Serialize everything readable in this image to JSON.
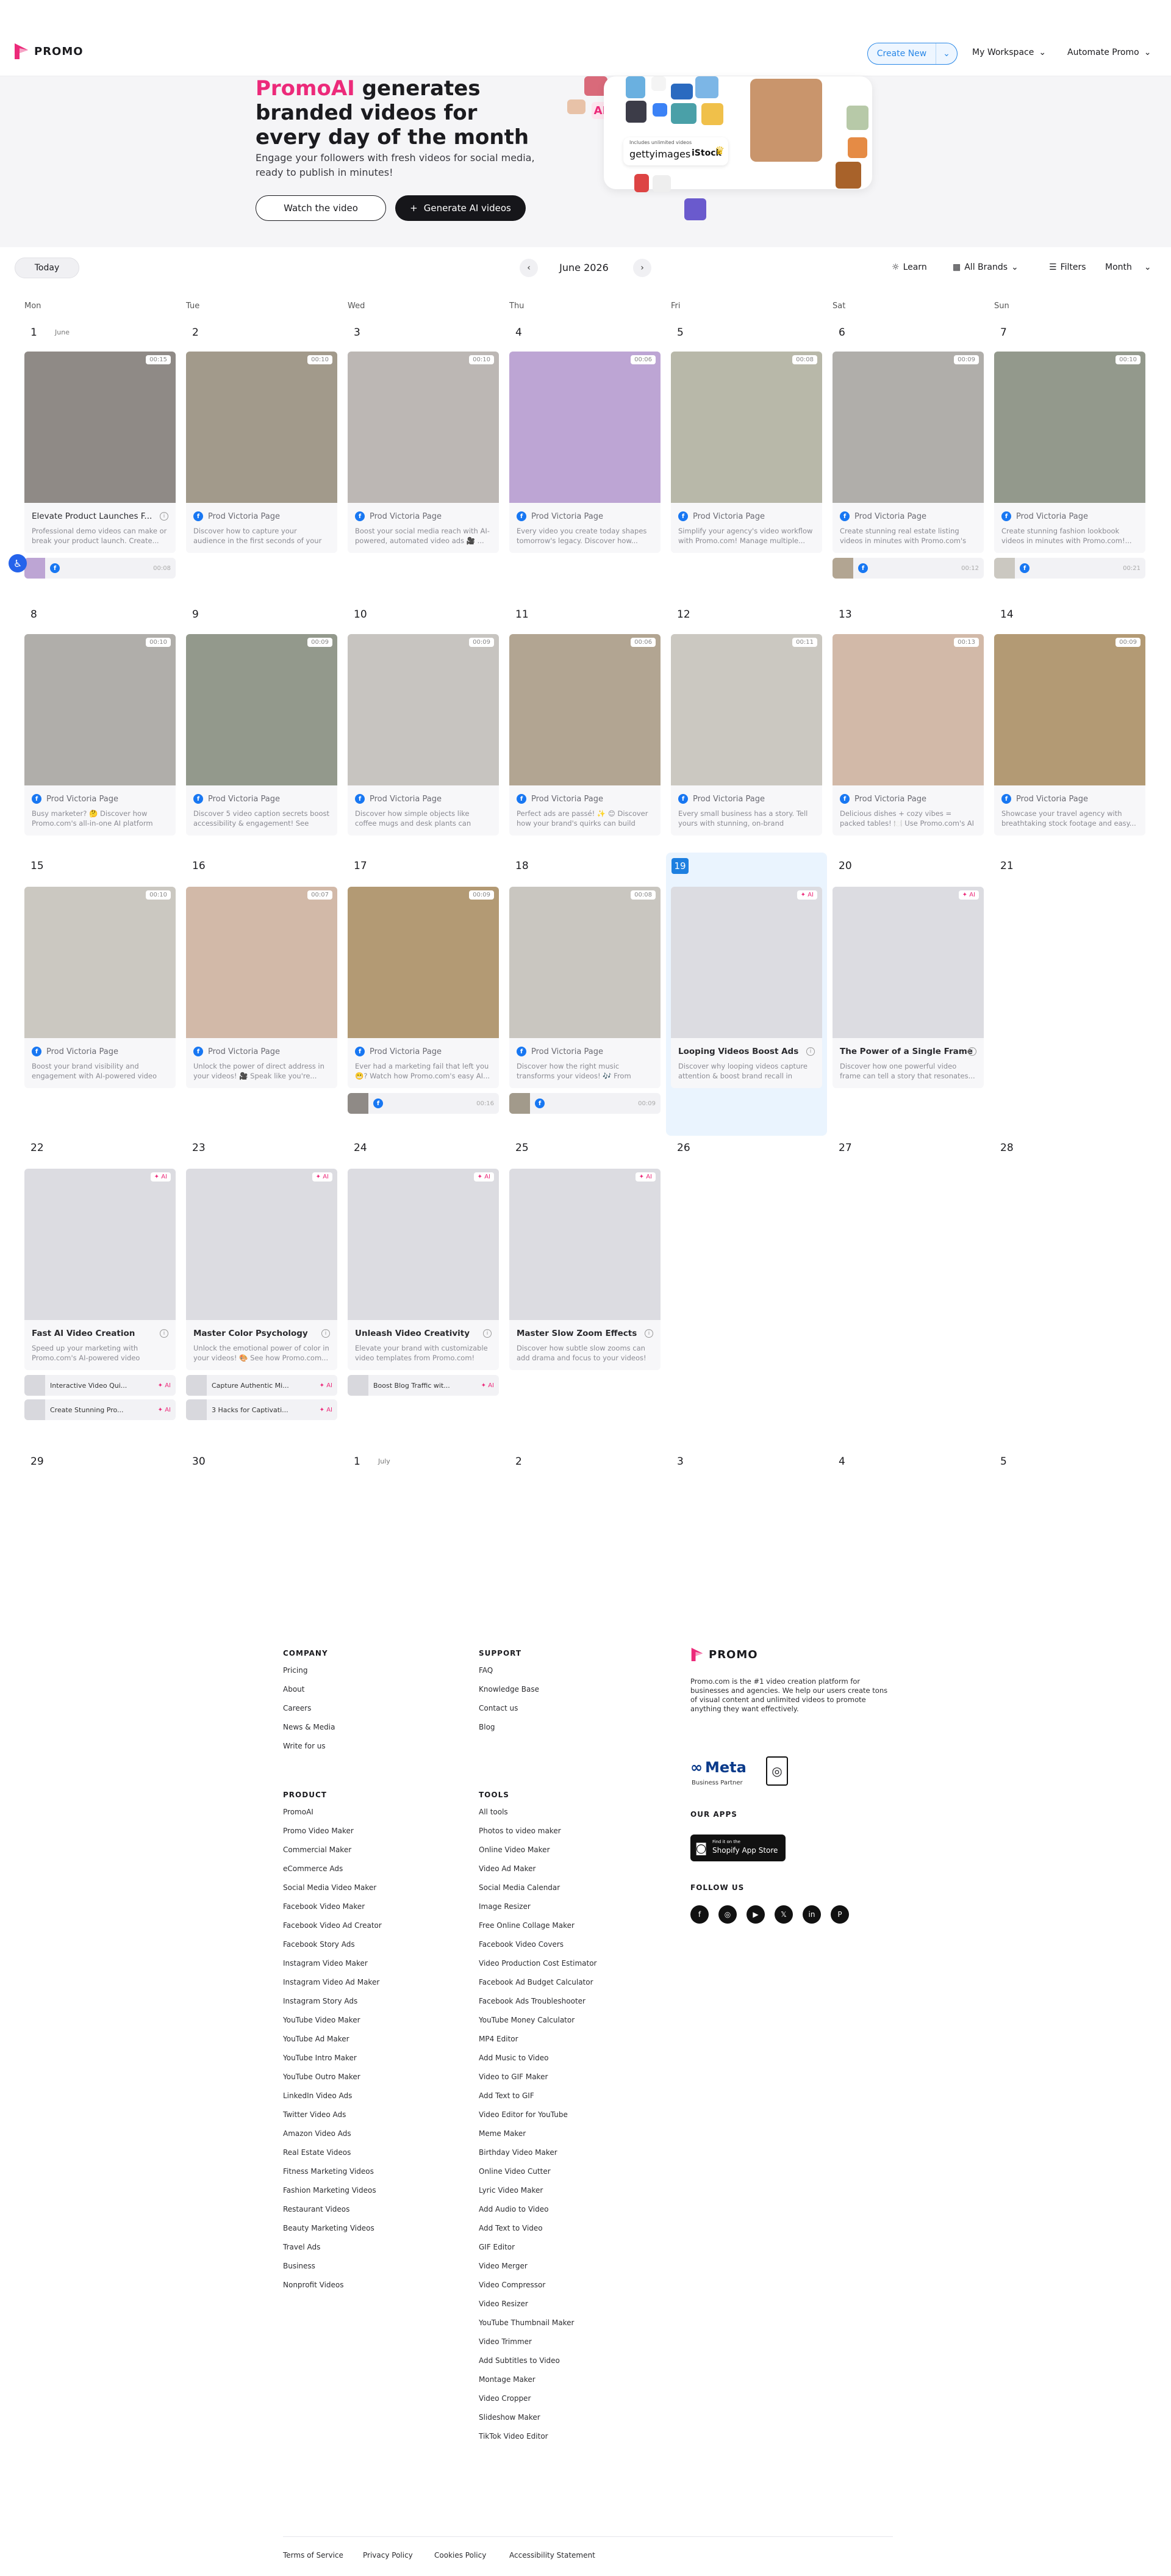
{
  "header": {
    "logo_text": "PROMO",
    "create_new": "Create New",
    "my_workspace": "My Workspace",
    "automate_promo": "Automate Promo"
  },
  "hero": {
    "title_highlight": "PromoAI",
    "title_rest": " generates branded videos for every day of the month",
    "subtitle": "Engage your followers with fresh videos for social media, ready to publish in minutes!",
    "watch_btn": "Watch the video",
    "generate_btn": "Generate AI videos",
    "collage_text1": "Includes unlimited videos",
    "collage_brand1": "gettyimages",
    "collage_brand2": "iStock",
    "collage_ai": "AI"
  },
  "toolbar": {
    "today": "Today",
    "month_label": "June 2026",
    "learn": "Learn",
    "all_brands": "All Brands",
    "filters": "Filters",
    "view": "Month"
  },
  "calendar": {
    "day_names": [
      "Mon",
      "Tue",
      "Wed",
      "Thu",
      "Fri",
      "Sat",
      "Sun"
    ],
    "month_tag_june": "June",
    "month_tag_july": "July",
    "page_name": "Prod Victoria Page",
    "ai_badge": "AI"
  },
  "cards": {
    "w1": [
      {
        "day": "1",
        "dur": "00:15",
        "title": "Elevate Product Launches F...",
        "desc": "Professional demo videos can make or break your product launch. Create...",
        "sub_time": "00:08"
      },
      {
        "day": "2",
        "dur": "00:10",
        "desc": "Discover how to capture your audience in the first seconds of your videos with..."
      },
      {
        "day": "3",
        "dur": "00:10",
        "desc": "Boost your social media reach with AI-powered, automated video ads 🎥 ..."
      },
      {
        "day": "4",
        "dur": "00:06",
        "desc": "Every video you create today shapes tomorrow's legacy. Discover how..."
      },
      {
        "day": "5",
        "dur": "00:08",
        "desc": "Simplify your agency's video workflow with Promo.com! Manage multiple..."
      },
      {
        "day": "6",
        "dur": "00:09",
        "desc": "Create stunning real estate listing videos in minutes with Promo.com's AI-...",
        "sub_time": "00:12"
      },
      {
        "day": "7",
        "dur": "00:10",
        "desc": "Create stunning fashion lookbook videos in minutes with Promo.com!...",
        "sub_time": "00:21"
      }
    ],
    "w2": [
      {
        "day": "8",
        "dur": "00:10",
        "desc": "Busy marketer? 🤔 Discover how Promo.com's all-in-one AI platform let..."
      },
      {
        "day": "9",
        "dur": "00:09",
        "desc": "Discover 5 video caption secrets boost accessibility & engagement! See how..."
      },
      {
        "day": "10",
        "dur": "00:09",
        "desc": "Discover how simple objects like coffee mugs and desk plants can spark your..."
      },
      {
        "day": "11",
        "dur": "00:06",
        "desc": "Perfect ads are passé! ✨ 😊 Discover how your brand's quirks can build trust..."
      },
      {
        "day": "12",
        "dur": "00:11",
        "desc": "Every small business has a story. Tell yours with stunning, on-brand videos..."
      },
      {
        "day": "13",
        "dur": "00:13",
        "desc": "Delicious dishes + cozy vibes = packed tables! 🍽️ Use Promo.com's AI tools to..."
      },
      {
        "day": "14",
        "dur": "00:09",
        "desc": "Showcase your travel agency with breathtaking stock footage and easy..."
      }
    ],
    "w3": [
      {
        "day": "15",
        "dur": "00:10",
        "desc": "Boost your brand visibility and engagement with AI-powered video a..."
      },
      {
        "day": "16",
        "dur": "00:07",
        "desc": "Unlock the power of direct address in your videos! 🎥 Speak like you're..."
      },
      {
        "day": "17",
        "dur": "00:09",
        "desc": "Ever had a marketing fail that left you 😬? Watch how Promo.com's easy AI...",
        "sub_time": "00:16"
      },
      {
        "day": "18",
        "dur": "00:08",
        "desc": "Discover how the right music transforms your videos! 🎶 From upbeat to...",
        "sub_time": "00:09"
      },
      {
        "day": "19",
        "title": "Looping Videos Boost Ads",
        "desc": "Discover why looping videos capture attention & boost brand recall in social..."
      },
      {
        "day": "20",
        "title": "The Power of a Single Frame",
        "desc": "Discover how one powerful video frame can tell a story that resonates..."
      },
      {
        "day": "21"
      }
    ],
    "w4": [
      {
        "day": "22",
        "title": "Fast AI Video Creation",
        "desc": "Speed up your marketing with Promo.com's AI-powered video creatio...",
        "subs": [
          "Interactive Video Qui...",
          "Create Stunning Pro..."
        ]
      },
      {
        "day": "23",
        "title": "Master Color Psychology",
        "desc": "Unlock the emotional power of color in your videos! 🎨 See how Promo.com...",
        "subs": [
          "Capture Authentic Mi...",
          "3 Hacks for Captivati..."
        ]
      },
      {
        "day": "24",
        "title": "Unleash Video Creativity",
        "desc": "Elevate your brand with customizable video templates from Promo.com! 🎬...",
        "subs": [
          "Boost Blog Traffic wit..."
        ]
      },
      {
        "day": "25",
        "title": "Master Slow Zoom Effects",
        "desc": "Discover how subtle slow zooms can add drama and focus to your videos! 🎥..."
      }
    ],
    "w4_empty": [
      "26",
      "27",
      "28"
    ],
    "w5": [
      "29",
      "30",
      "1",
      "2",
      "3",
      "4",
      "5"
    ]
  },
  "footer": {
    "company_head": "COMPANY",
    "company": [
      "Pricing",
      "About",
      "Careers",
      "News & Media",
      "Write for us"
    ],
    "support_head": "SUPPORT",
    "support": [
      "FAQ",
      "Knowledge Base",
      "Contact us",
      "Blog"
    ],
    "product_head": "PRODUCT",
    "product": [
      "PromoAI",
      "Promo Video Maker",
      "Commercial Maker",
      "eCommerce Ads",
      "Social Media Video Maker",
      "Facebook Video Maker",
      "Facebook Video Ad Creator",
      "Facebook Story Ads",
      "Instagram Video Maker",
      "Instagram Video Ad Maker",
      "Instagram Story Ads",
      "YouTube Video Maker",
      "YouTube Ad Maker",
      "YouTube Intro Maker",
      "YouTube Outro Maker",
      "LinkedIn Video Ads",
      "Twitter Video Ads",
      "Amazon Video Ads",
      "Real Estate Videos",
      "Fitness Marketing Videos",
      "Fashion Marketing Videos",
      "Restaurant Videos",
      "Beauty Marketing Videos",
      "Travel Ads",
      "Business",
      "Nonprofit Videos"
    ],
    "tools_head": "TOOLS",
    "tools": [
      "All tools",
      "Photos to video maker",
      "Online Video Maker",
      "Video Ad Maker",
      "Social Media Calendar",
      "Image Resizer",
      "Free Online Collage Maker",
      "Facebook Video Covers",
      "Video Production Cost Estimator",
      "Facebook Ad Budget Calculator",
      "Facebook Ads Troubleshooter",
      "YouTube Money Calculator",
      "MP4 Editor",
      "Add Music to Video",
      "Video to GIF Maker",
      "Add Text to GIF",
      "Video Editor for YouTube",
      "Meme Maker",
      "Birthday Video Maker",
      "Online Video Cutter",
      "Lyric Video Maker",
      "Add Audio to Video",
      "Add Text to Video",
      "GIF Editor",
      "Video Merger",
      "Video Compressor",
      "Video Resizer",
      "YouTube Thumbnail Maker",
      "Video Trimmer",
      "Add Subtitles to Video",
      "Montage Maker",
      "Video Cropper",
      "Slideshow Maker",
      "TikTok Video Editor"
    ],
    "brand": "PROMO",
    "about": "Promo.com is the #1 video creation platform for businesses and agencies. We help our users create tons of visual content and unlimited videos to promote anything they want effectively.",
    "meta": "Meta",
    "meta_sub": "Business Partner",
    "apps_head": "OUR APPS",
    "app_store_small": "Find it on the",
    "app_store": "Shopify App Store",
    "follow_head": "FOLLOW US",
    "legal": [
      "Terms of Service",
      "Privacy Policy",
      "Cookies Policy",
      "Accessibility Statement"
    ]
  },
  "colors": {
    "accent_pink": "#ec2a7a",
    "accent_blue": "#2a88e7",
    "today_bg": "#eaf4fe"
  }
}
